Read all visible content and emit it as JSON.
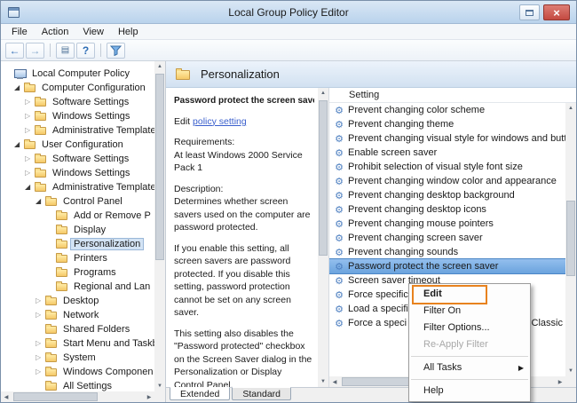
{
  "window": {
    "title": "Local Group Policy Editor",
    "controls": {
      "maximize_glyph": "",
      "close_glyph": "×"
    }
  },
  "menu_bar": {
    "items": [
      "File",
      "Action",
      "View",
      "Help"
    ]
  },
  "toolbar": {
    "icons": [
      "back-arrow",
      "forward-arrow",
      "console-tree",
      "help",
      "filter"
    ]
  },
  "icons": {
    "back": "←",
    "forward": "→",
    "console_tree": "▤",
    "help": "?",
    "filter": "funnel-svg",
    "folder": "css-folder-shape",
    "computer": "css-computer-shape",
    "policy_setting": "⚙",
    "collapsed_arrow": "▷",
    "expanded_arrow": "◢",
    "submenu_arrow": "▶",
    "close": "×",
    "scroll_up": "▲",
    "scroll_down": "▼",
    "scroll_left": "◀",
    "scroll_right": "▶"
  },
  "tree": {
    "items": [
      {
        "label": "Local Computer Policy",
        "level": 0,
        "arrow": "none",
        "icon": "computer",
        "selected": false
      },
      {
        "label": "Computer Configuration",
        "level": 1,
        "arrow": "expanded",
        "icon": "folder",
        "selected": false
      },
      {
        "label": "Software Settings",
        "level": 2,
        "arrow": "collapsed",
        "icon": "folder",
        "selected": false
      },
      {
        "label": "Windows Settings",
        "level": 2,
        "arrow": "collapsed",
        "icon": "folder",
        "selected": false
      },
      {
        "label": "Administrative Template",
        "level": 2,
        "arrow": "collapsed",
        "icon": "folder",
        "selected": false
      },
      {
        "label": "User Configuration",
        "level": 1,
        "arrow": "expanded",
        "icon": "folder",
        "selected": false
      },
      {
        "label": "Software Settings",
        "level": 2,
        "arrow": "collapsed",
        "icon": "folder",
        "selected": false
      },
      {
        "label": "Windows Settings",
        "level": 2,
        "arrow": "collapsed",
        "icon": "folder",
        "selected": false
      },
      {
        "label": "Administrative Template",
        "level": 2,
        "arrow": "expanded",
        "icon": "folder",
        "selected": false
      },
      {
        "label": "Control Panel",
        "level": 3,
        "arrow": "expanded",
        "icon": "folder",
        "selected": false
      },
      {
        "label": "Add or Remove P",
        "level": 4,
        "arrow": "none",
        "icon": "folder",
        "selected": false
      },
      {
        "label": "Display",
        "level": 4,
        "arrow": "none",
        "icon": "folder",
        "selected": false
      },
      {
        "label": "Personalization",
        "level": 4,
        "arrow": "none",
        "icon": "folder",
        "selected": true
      },
      {
        "label": "Printers",
        "level": 4,
        "arrow": "none",
        "icon": "folder",
        "selected": false
      },
      {
        "label": "Programs",
        "level": 4,
        "arrow": "none",
        "icon": "folder",
        "selected": false
      },
      {
        "label": "Regional and Lan",
        "level": 4,
        "arrow": "none",
        "icon": "folder",
        "selected": false
      },
      {
        "label": "Desktop",
        "level": 3,
        "arrow": "collapsed",
        "icon": "folder",
        "selected": false
      },
      {
        "label": "Network",
        "level": 3,
        "arrow": "collapsed",
        "icon": "folder",
        "selected": false
      },
      {
        "label": "Shared Folders",
        "level": 3,
        "arrow": "none",
        "icon": "folder",
        "selected": false
      },
      {
        "label": "Start Menu and Taskb",
        "level": 3,
        "arrow": "collapsed",
        "icon": "folder",
        "selected": false
      },
      {
        "label": "System",
        "level": 3,
        "arrow": "collapsed",
        "icon": "folder",
        "selected": false
      },
      {
        "label": "Windows Componen",
        "level": 3,
        "arrow": "collapsed",
        "icon": "folder",
        "selected": false
      },
      {
        "label": "All Settings",
        "level": 3,
        "arrow": "none",
        "icon": "folder",
        "selected": false,
        "partial": true
      }
    ]
  },
  "details": {
    "header_title": "Personalization",
    "policy": {
      "title": "Password protect the screen saver",
      "edit_prefix": "Edit",
      "edit_link": "policy setting",
      "requirements_label": "Requirements:",
      "requirements": "At least Windows 2000 Service Pack 1",
      "description_label": "Description:",
      "paragraph_1": "Determines whether screen savers used on the computer are password protected.",
      "paragraph_2": "If you enable this setting, all screen savers are password protected. If you disable this setting, password protection cannot be set on any screen saver.",
      "paragraph_3": "This setting also disables the \"Password protected\" checkbox on the Screen Saver dialog in the Personalization or Display Control Panel."
    },
    "list": {
      "column_header": "Setting",
      "items": [
        "Prevent changing color scheme",
        "Prevent changing theme",
        "Prevent changing visual style for windows and buttons",
        "Enable screen saver",
        "Prohibit selection of visual style font size",
        "Prevent changing window color and appearance",
        "Prevent changing desktop background",
        "Prevent changing desktop icons",
        "Prevent changing mouse pointers",
        "Prevent changing screen saver",
        "Prevent changing sounds",
        "Password protect the screen saver",
        "Screen saver timeout",
        "Force specific screen saver",
        "Load a specific theme",
        "Force a specific visual style file or force Windows Classic"
      ],
      "last_item_visible_tail": "Classic",
      "selected_item": "Password protect the screen saver"
    },
    "tabs": {
      "extended": "Extended",
      "standard": "Standard",
      "active": "Extended"
    }
  },
  "context_menu": {
    "items": {
      "edit": "Edit",
      "filter_on": "Filter On",
      "filter_options": "Filter Options...",
      "reapply_filter": "Re-Apply Filter",
      "all_tasks": "All Tasks",
      "help": "Help"
    },
    "disabled_items": [
      "Re-Apply Filter"
    ],
    "default_item": "Edit",
    "submenu_arrow": "▶"
  },
  "annotation": {
    "type": "highlight-box",
    "target": "Edit",
    "color": "#e8821e"
  },
  "colors": {
    "titlebar": "#bed7ef",
    "close_button": "#c9443c",
    "selection_blue": "#79aae0",
    "tree_selection": "#d3e3f4",
    "link_blue": "#3a5fcd",
    "annotation_orange": "#e8821e"
  }
}
